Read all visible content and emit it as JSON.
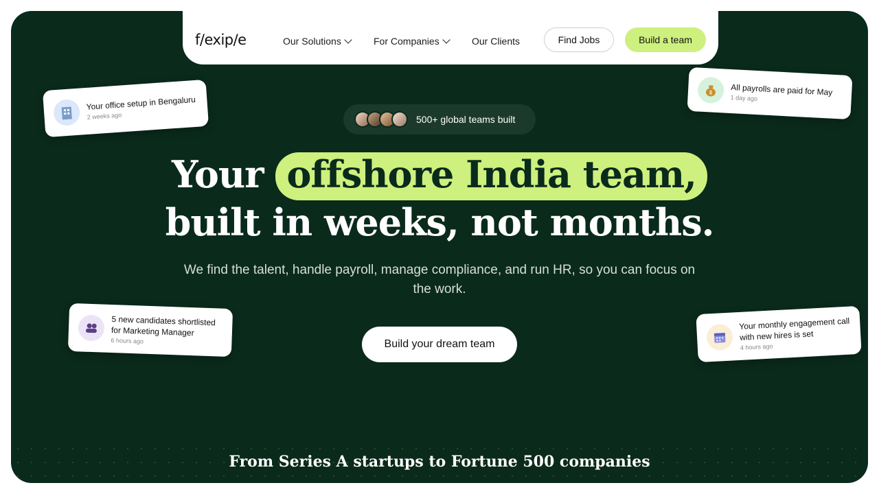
{
  "nav": {
    "logo": "f/exip/e",
    "items": [
      {
        "label": "Our Solutions",
        "has_dropdown": true
      },
      {
        "label": "For Companies",
        "has_dropdown": true
      },
      {
        "label": "Our Clients",
        "has_dropdown": false
      }
    ],
    "find_jobs_label": "Find Jobs",
    "build_team_label": "Build a team"
  },
  "badge": {
    "text": "500+ global teams built"
  },
  "headline": {
    "line1_prefix": "Your",
    "line1_highlight": "offshore India team,",
    "line2": "built in weeks, not months."
  },
  "subheadline": "We find the talent, handle payroll, manage compliance, and run HR, so you can focus on the work.",
  "cta_label": "Build your dream team",
  "bottom_text": "From Series A startups to Fortune 500 companies",
  "cards": [
    {
      "title": "Your office setup in Bengaluru",
      "time": "2 weeks ago",
      "icon": "office-building-icon"
    },
    {
      "title": "All payrolls are paid for May",
      "time": "1 day ago",
      "icon": "money-bag-icon"
    },
    {
      "title": "5 new candidates shortlisted for Marketing Manager",
      "time": "6 hours ago",
      "icon": "people-icon"
    },
    {
      "title": "Your monthly engagement call with new hires is set",
      "time": "4 hours ago",
      "icon": "calendar-icon"
    }
  ],
  "colors": {
    "background": "#0a2a1c",
    "accent": "#cdf07e",
    "white": "#ffffff"
  }
}
